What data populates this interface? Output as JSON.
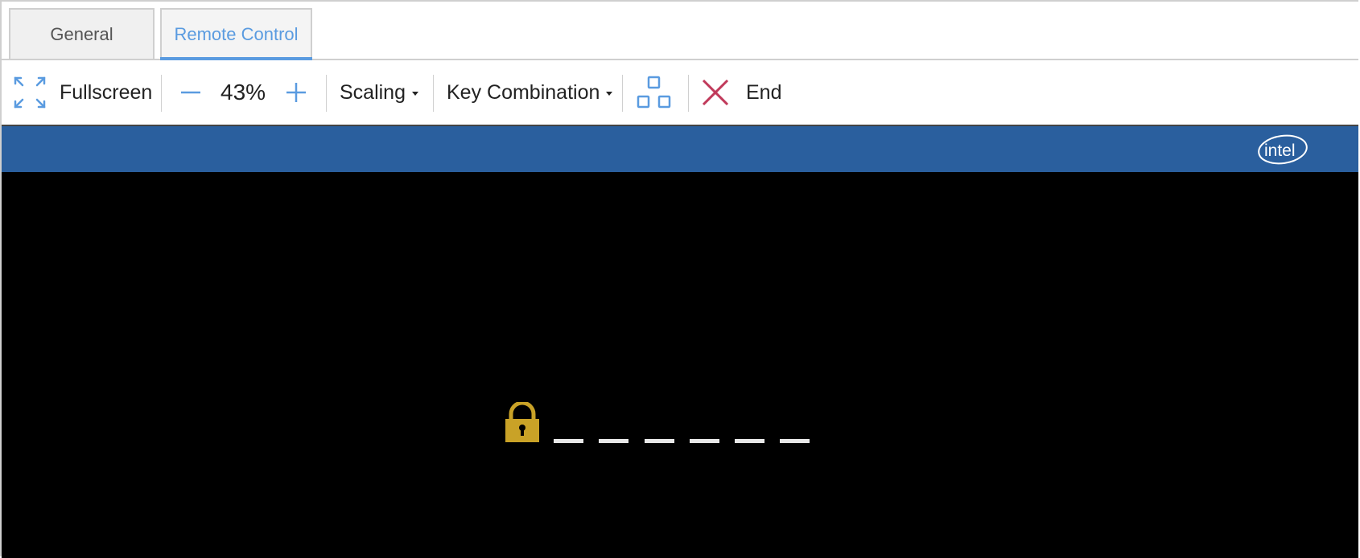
{
  "tabs": {
    "general": "General",
    "remote_control": "Remote Control",
    "active": "Remote Control"
  },
  "toolbar": {
    "fullscreen_label": "Fullscreen",
    "zoom_level": "43%",
    "scaling_label": "Scaling",
    "key_combination_label": "Key Combination",
    "end_label": "End"
  },
  "remote_screen": {
    "logo_text": "intel",
    "pin_slots": 6
  },
  "colors": {
    "accent": "#5a9be0",
    "end_icon": "#c0395a",
    "screen_header": "#2a5f9e",
    "lock": "#c9a227"
  },
  "icons": {
    "fullscreen": "fullscreen-icon",
    "zoom_out": "minus-icon",
    "zoom_in": "plus-icon",
    "layout": "window-layout-icon",
    "end": "close-icon",
    "lock": "lock-icon"
  }
}
